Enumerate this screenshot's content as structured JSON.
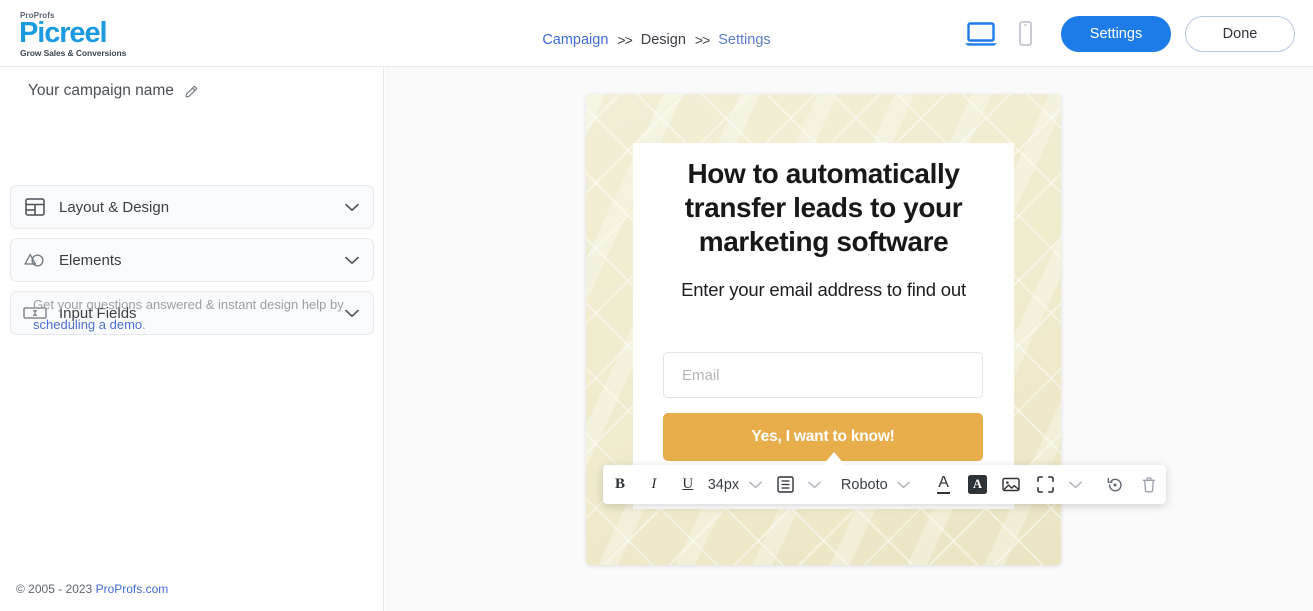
{
  "brand": {
    "top": "ProProfs",
    "name": "Picreel",
    "tagline": "Grow Sales & Conversions",
    "color": "#1b9ae0"
  },
  "header": {
    "breadcrumb": [
      {
        "label": "Campaign",
        "state": "link"
      },
      {
        "label": ">>",
        "state": "separator"
      },
      {
        "label": "Design",
        "state": "active"
      },
      {
        "label": ">>",
        "state": "separator"
      },
      {
        "label": "Settings",
        "state": "current"
      }
    ],
    "device_toggle": [
      {
        "name": "desktop-view-icon",
        "selected": true,
        "color": "#1e7ce8"
      },
      {
        "name": "mobile-view-icon",
        "selected": false,
        "color": "#b9bfc8"
      }
    ],
    "settings_button": "Settings",
    "done_button": "Done",
    "primary_color": "#1e7ce8"
  },
  "sidebar": {
    "campaign_name": "Your campaign name",
    "edit_icon": "pencil-icon",
    "panels": [
      {
        "label": "Layout & Design",
        "icon": "layout-grid-icon",
        "expanded": false
      },
      {
        "label": "Elements",
        "icon": "shapes-icon",
        "expanded": false
      },
      {
        "label": "Input Fields",
        "icon": "input-field-icon",
        "expanded": false
      }
    ],
    "help": {
      "text": "Get your questions answered & instant design help by ",
      "link": "scheduling a demo",
      "suffix": "."
    },
    "footer": {
      "copyright": "© 2005 - 2023 ",
      "link": "ProProfs.com"
    }
  },
  "popup": {
    "headline": "How to automatically transfer leads to your marketing software",
    "subtext": "Enter your email address to find out",
    "email_placeholder": "Email",
    "cta_label": "Yes, I want to know!",
    "cta_color": "#e8ae4c",
    "background_color": "#efebcd"
  },
  "toolbar": {
    "items": [
      {
        "name": "bold-button",
        "label": "B",
        "type": "text"
      },
      {
        "name": "italic-button",
        "label": "I",
        "type": "text"
      },
      {
        "name": "underline-button",
        "label": "U",
        "type": "text"
      },
      {
        "name": "font-size-value",
        "label": "34px",
        "type": "value"
      },
      {
        "name": "align-button",
        "label": "align-center-icon",
        "type": "icon"
      },
      {
        "name": "font-family-value",
        "label": "Roboto",
        "type": "value"
      },
      {
        "name": "text-color-button",
        "label": "text-color-icon",
        "type": "icon"
      },
      {
        "name": "highlight-color-button",
        "label": "A",
        "type": "highlight"
      },
      {
        "name": "insert-image-button",
        "label": "image-icon",
        "type": "icon"
      },
      {
        "name": "border-button",
        "label": "crop-frame-icon",
        "type": "icon"
      },
      {
        "name": "reset-button",
        "label": "revert-icon",
        "type": "icon"
      },
      {
        "name": "delete-button",
        "label": "trash-icon",
        "type": "icon"
      }
    ],
    "font_size": "34px",
    "font_family": "Roboto"
  }
}
